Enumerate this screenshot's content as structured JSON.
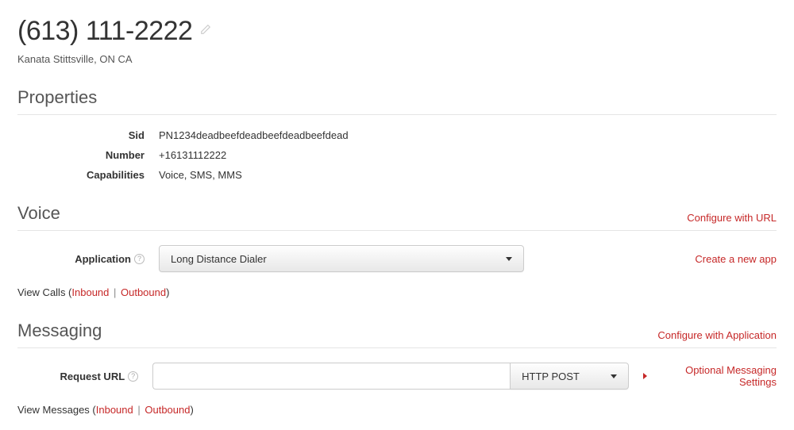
{
  "header": {
    "phone": "(613) 111-2222",
    "location": "Kanata Stittsville, ON CA"
  },
  "properties": {
    "title": "Properties",
    "rows": [
      {
        "label": "Sid",
        "value": "PN1234deadbeefdeadbeefdeadbeefdead"
      },
      {
        "label": "Number",
        "value": "+16131112222"
      },
      {
        "label": "Capabilities",
        "value": "Voice, SMS, MMS"
      }
    ]
  },
  "voice": {
    "title": "Voice",
    "configure_link": "Configure with URL",
    "application_label": "Application",
    "application_value": "Long Distance Dialer",
    "create_app_link": "Create a new app",
    "view_prefix": "View Calls (",
    "inbound": "Inbound",
    "outbound": "Outbound",
    "view_suffix": ")"
  },
  "messaging": {
    "title": "Messaging",
    "configure_link": "Configure with Application",
    "request_url_label": "Request URL",
    "request_url_value": "",
    "method": "HTTP POST",
    "optional_link": "Optional Messaging Settings",
    "view_prefix": "View Messages (",
    "inbound": "Inbound",
    "outbound": "Outbound",
    "view_suffix": ")"
  }
}
